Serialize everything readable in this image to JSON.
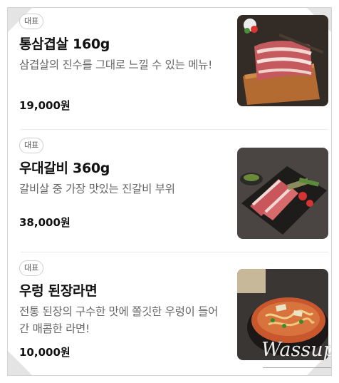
{
  "menu": {
    "items": [
      {
        "badge": "대표",
        "name": "통삼겹살 160g",
        "description": "삼겹살의 진수를 그대로 느낄 수 있는 메뉴!",
        "price": "19,000원",
        "image": "pork-belly-on-cutting-board"
      },
      {
        "badge": "대표",
        "name": "우대갈비 360g",
        "description": "갈비살 중 가장 맛있는 진갈비 부위",
        "price": "38,000원",
        "image": "beef-ribs-on-slate"
      },
      {
        "badge": "대표",
        "name": "우렁 된장라면",
        "description": "전통 된장의 구수한 맛에 쫄깃한 우렁이 들어간 매콤한 라면!",
        "price": "10,000원",
        "image": "doenjang-ramen-pot"
      }
    ]
  },
  "watermark": {
    "text": "Wassup"
  },
  "colors": {
    "text_primary": "#111111",
    "text_secondary": "#666666",
    "badge_border": "#cfcfcf",
    "divider": "#ececec"
  }
}
